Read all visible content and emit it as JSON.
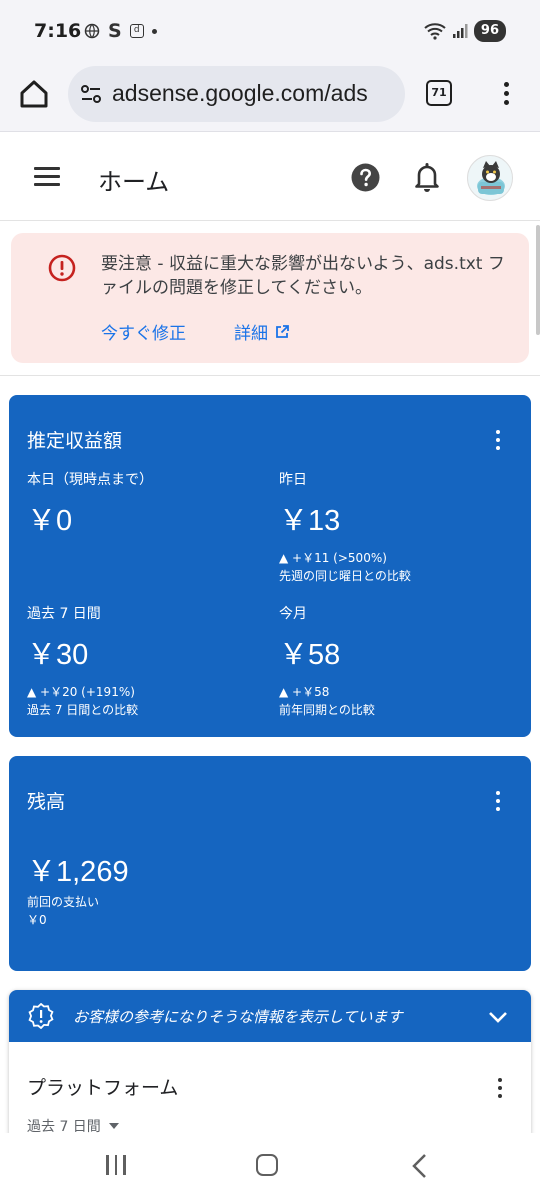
{
  "status_bar": {
    "time": "7:16",
    "s_icon": "S",
    "d_icon": "d",
    "battery": "96"
  },
  "browser": {
    "url": "adsense.google.com/ads",
    "tab_count": "71"
  },
  "header": {
    "title": "ホーム"
  },
  "alert": {
    "message": "要注意 - 収益に重大な影響が出ないよう、ads.txt ファイルの問題を修正してください。",
    "fix_label": "今すぐ修正",
    "details_label": "詳細"
  },
  "earnings": {
    "title": "推定収益額",
    "metrics": [
      {
        "label": "本日（現時点まで）",
        "value": "￥0",
        "change": "",
        "compare": ""
      },
      {
        "label": "昨日",
        "value": "￥13",
        "change": "▲ +￥11 (>500%)",
        "compare": "先週の同じ曜日との比較"
      },
      {
        "label": "過去 7 日間",
        "value": "￥30",
        "change": "▲ +￥20 (+191%)",
        "compare": "過去 7 日間との比較"
      },
      {
        "label": "今月",
        "value": "￥58",
        "change": "▲ +￥58",
        "compare": "前年同期との比較"
      }
    ]
  },
  "balance": {
    "title": "残高",
    "value": "￥1,269",
    "last_payment_label": "前回の支払い",
    "last_payment_value": "￥0"
  },
  "info": {
    "banner": "お客様の参考になりそうな情報を表示しています",
    "platform_title": "プラットフォーム",
    "period": "過去 7 日間"
  },
  "colors": {
    "card_blue": "#1565c0",
    "alert_bg": "#fce8e6",
    "link_blue": "#1a73e8",
    "error_red": "#c5221f"
  }
}
